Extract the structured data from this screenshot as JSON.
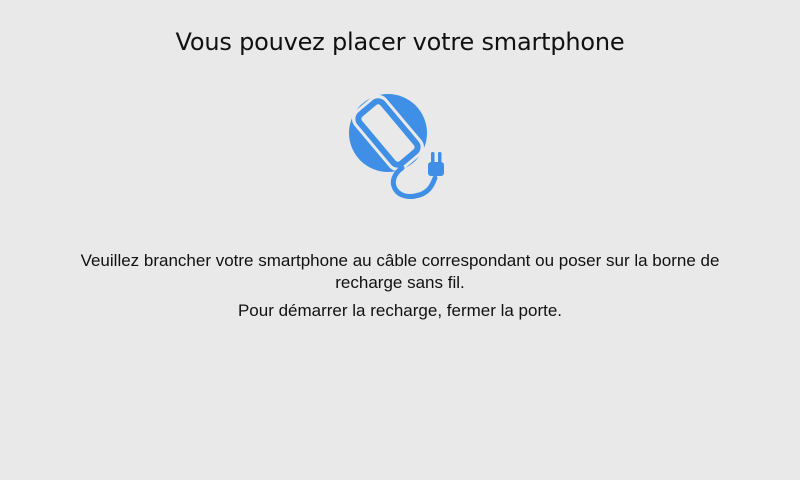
{
  "screen": {
    "title": "Vous pouvez placer votre smartphone",
    "icon": "phone-charging-plug-icon",
    "accent_color": "#3f8fe6",
    "instruction": "Veuillez brancher votre smartphone au câble correspondant ou poser sur la borne de recharge sans fil.",
    "start_hint": "Pour démarrer la recharge, fermer la porte."
  }
}
